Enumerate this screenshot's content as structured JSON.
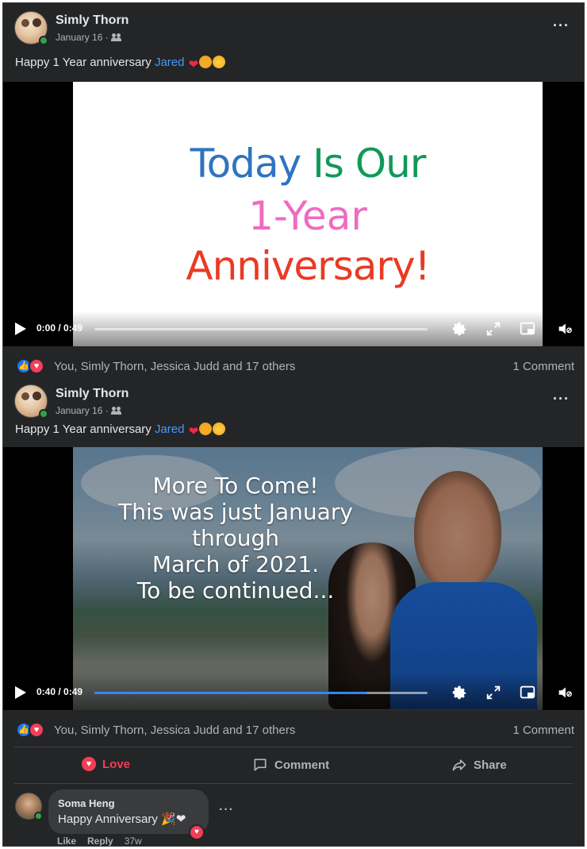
{
  "posts": [
    {
      "author": "Simly Thorn",
      "date": "January 16 · ",
      "caption_text": "Happy 1 Year anniversary ",
      "mention": "Jared",
      "caption_emoji": [
        "❤",
        "🤣",
        "😁"
      ],
      "video": {
        "slide_lines": [
          "Today",
          "Is Our",
          "1-Year",
          "Anniversary!"
        ],
        "time": "0:00 / 0:49",
        "progress": 0.0
      },
      "reactions_text": "You, Simly Thorn, Jessica Judd and 17 others",
      "comment_count": "1 Comment",
      "more_label": "···"
    },
    {
      "author": "Simly Thorn",
      "date": "January 16 · ",
      "caption_text": "Happy 1 Year anniversary ",
      "mention": "Jared",
      "caption_emoji": [
        "❤",
        "🤣",
        "😁"
      ],
      "video": {
        "overlay_lines": [
          "More To Come!",
          "This was just January through",
          "March of 2021.",
          "To be continued..."
        ],
        "time": "0:40 / 0:49",
        "progress": 0.82
      },
      "reactions_text": "You, Simly Thorn, Jessica Judd and 17 others",
      "comment_count": "1 Comment",
      "more_label": "···"
    }
  ],
  "actions": {
    "love": "Love",
    "comment": "Comment",
    "share": "Share"
  },
  "comment": {
    "name": "Soma Heng",
    "text": "Happy Anniversary 🎉❤",
    "like": "Like",
    "reply": "Reply",
    "age": "37w",
    "more_label": "···"
  },
  "icons": {
    "like": "like-icon",
    "love": "love-icon",
    "gear": "gear-icon",
    "expand": "expand-icon",
    "pip": "pip-icon",
    "volume": "volume-icon",
    "play": "play-icon",
    "people": "friends-audience-icon"
  },
  "colors": {
    "background": "#242526",
    "mention": "#4599ff",
    "love": "#f33e58",
    "like": "#1877f2",
    "progress": "#2d88ff"
  }
}
